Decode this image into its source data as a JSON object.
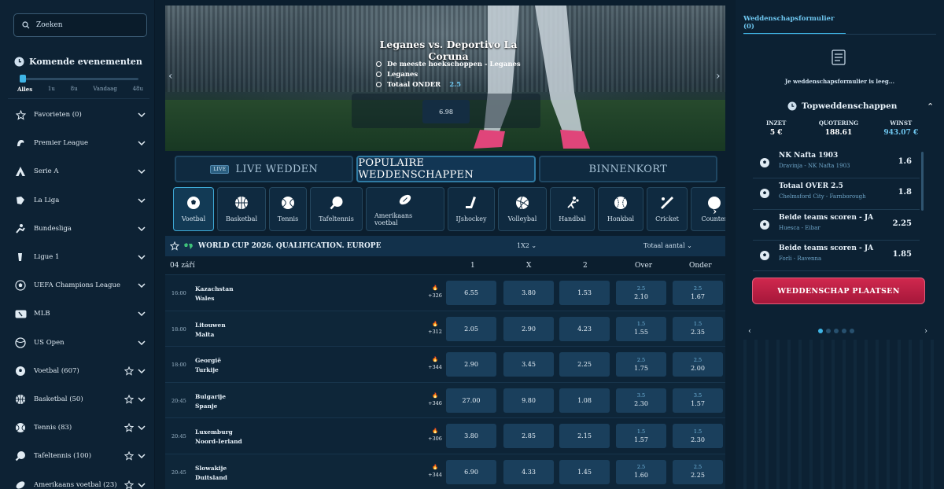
{
  "search": {
    "placeholder": "Zoeken"
  },
  "upcoming": {
    "title": "Komende evenementen",
    "ranges": [
      "Alles",
      "1u",
      "8u",
      "Vandaag",
      "48u"
    ]
  },
  "sidebar": {
    "items": [
      {
        "label": "Favorieten (0)",
        "icon": "star-icon",
        "star": false
      },
      {
        "label": "Premier League",
        "icon": "premier-league-icon",
        "star": false
      },
      {
        "label": "Serie A",
        "icon": "serie-a-icon",
        "star": false
      },
      {
        "label": "La Liga",
        "icon": "la-liga-icon",
        "star": false
      },
      {
        "label": "Bundesliga",
        "icon": "bundesliga-icon",
        "star": false
      },
      {
        "label": "Ligue 1",
        "icon": "ligue-1-icon",
        "star": false
      },
      {
        "label": "UEFA Champions League",
        "icon": "champions-league-icon",
        "star": false
      },
      {
        "label": "MLB",
        "icon": "mlb-icon",
        "star": false
      },
      {
        "label": "US Open",
        "icon": "us-open-icon",
        "star": false
      },
      {
        "label": "Voetbal (607)",
        "icon": "soccer-ball-icon",
        "star": true
      },
      {
        "label": "Basketbal (50)",
        "icon": "basketball-icon",
        "star": true
      },
      {
        "label": "Tennis (83)",
        "icon": "tennis-ball-icon",
        "star": true
      },
      {
        "label": "Tafeltennis (100)",
        "icon": "table-tennis-icon",
        "star": true
      },
      {
        "label": "Amerikaans voetbal (23)",
        "icon": "american-football-icon",
        "star": true
      }
    ]
  },
  "banner": {
    "title": "Leganes  vs.  Deportivo La Coruna",
    "lines": [
      {
        "text": "De meeste hoekschoppen - Leganes",
        "value": ""
      },
      {
        "text": "Leganes",
        "value": ""
      },
      {
        "text": "Totaal ONDER",
        "value": "2.5"
      }
    ],
    "odds": "6.98"
  },
  "tabs": {
    "live": "LIVE WEDDEN",
    "live_badge": "LIVE",
    "popular": "POPULAIRE WEDDENSCHAPPEN",
    "soon": "BINNENKORT"
  },
  "sports": [
    "Voetbal",
    "Basketbal",
    "Tennis",
    "Tafeltennis",
    "Amerikaans voetbal",
    "IJshockey",
    "Volleybal",
    "Handbal",
    "Honkbal",
    "Cricket",
    "Counter"
  ],
  "league": {
    "name": "WORLD CUP 2026. QUALIFICATION. EUROPE",
    "market1": "1X2",
    "market2": "Totaal aantal"
  },
  "table": {
    "date": "04 září",
    "headers": [
      "1",
      "X",
      "2",
      "Over",
      "Onder"
    ],
    "rows": [
      {
        "time": "16:00",
        "home": "Kazachstan",
        "away": "Wales",
        "count": "+326",
        "o1": "6.55",
        "ox": "3.80",
        "o2": "1.53",
        "over_line": "2.5",
        "over": "2.10",
        "under_line": "2.5",
        "under": "1.67"
      },
      {
        "time": "18:00",
        "home": "Litouwen",
        "away": "Malta",
        "count": "+312",
        "o1": "2.05",
        "ox": "2.90",
        "o2": "4.23",
        "over_line": "1.5",
        "over": "1.55",
        "under_line": "1.5",
        "under": "2.35"
      },
      {
        "time": "18:00",
        "home": "Georgië",
        "away": "Turkije",
        "count": "+344",
        "o1": "2.90",
        "ox": "3.45",
        "o2": "2.25",
        "over_line": "2.5",
        "over": "1.75",
        "under_line": "2.5",
        "under": "2.00"
      },
      {
        "time": "20:45",
        "home": "Bulgarije",
        "away": "Spanje",
        "count": "+346",
        "o1": "27.00",
        "ox": "9.80",
        "o2": "1.08",
        "over_line": "3.5",
        "over": "2.30",
        "under_line": "3.5",
        "under": "1.57"
      },
      {
        "time": "20:45",
        "home": "Luxemburg",
        "away": "Noord-Ierland",
        "count": "+306",
        "o1": "3.80",
        "ox": "2.85",
        "o2": "2.15",
        "over_line": "1.5",
        "over": "1.57",
        "under_line": "1.5",
        "under": "2.30"
      },
      {
        "time": "20:45",
        "home": "Slowakije",
        "away": "Duitsland",
        "count": "+344",
        "o1": "6.90",
        "ox": "4.33",
        "o2": "1.45",
        "over_line": "2.5",
        "over": "1.60",
        "under_line": "2.5",
        "under": "2.25"
      }
    ]
  },
  "betslip": {
    "tab": "Weddenschapsformulier (0)",
    "empty": "Je weddenschapsformulier is leeg...",
    "top_title": "Topweddenschappen",
    "stake_label": "INZET",
    "stake": "5 €",
    "odds_label": "QUOTERING",
    "odds": "188.61",
    "win_label": "WINST",
    "win": "943.07 €",
    "top": [
      {
        "title": "NK Nafta 1903",
        "sub": "Dravinja - NK Nafta 1903",
        "odd": "1.6"
      },
      {
        "title": "Totaal OVER 2.5",
        "sub": "Chelmsford City - Farnborough",
        "odd": "1.8"
      },
      {
        "title": "Beide teams scoren - JA",
        "sub": "Huesca - Eibar",
        "odd": "2.25"
      },
      {
        "title": "Beide teams scoren - JA",
        "sub": "Forli - Ravenna",
        "odd": "1.85"
      }
    ],
    "place": "WEDDENSCHAP PLAATSEN"
  },
  "colors": {
    "accent": "#3fb5e6",
    "place_button": "#c0213f",
    "background": "#0b1e2e"
  }
}
